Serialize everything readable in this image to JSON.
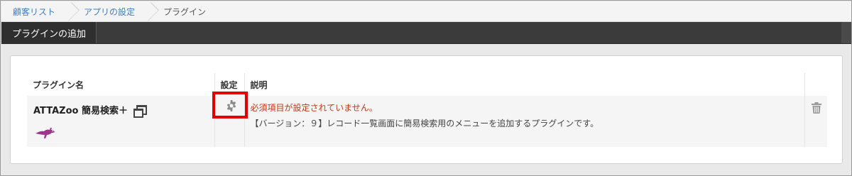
{
  "breadcrumb": {
    "items": [
      {
        "label": "顧客リスト"
      },
      {
        "label": "アプリの設定"
      },
      {
        "label": "プラグイン"
      }
    ]
  },
  "header": {
    "tab_label": "プラグインの追加"
  },
  "table": {
    "columns": [
      "プラグイン名",
      "設定",
      "説明",
      ""
    ],
    "rows": [
      {
        "name": "ATTAZoo 簡易検索＋",
        "warning": "必須項目が設定されていません。",
        "description": "【バージョン：９】レコード一覧画面に簡易検索用のメニューを追加するプラグインです。"
      }
    ]
  },
  "colors": {
    "link": "#3f7dbf",
    "warning": "#c0391b",
    "highlight": "#e40000",
    "header_bg": "#3b3b3b",
    "logo": "#a0338a"
  },
  "icons": [
    "window-icon",
    "gear-icon",
    "trash-icon",
    "kangaroo-logo"
  ]
}
